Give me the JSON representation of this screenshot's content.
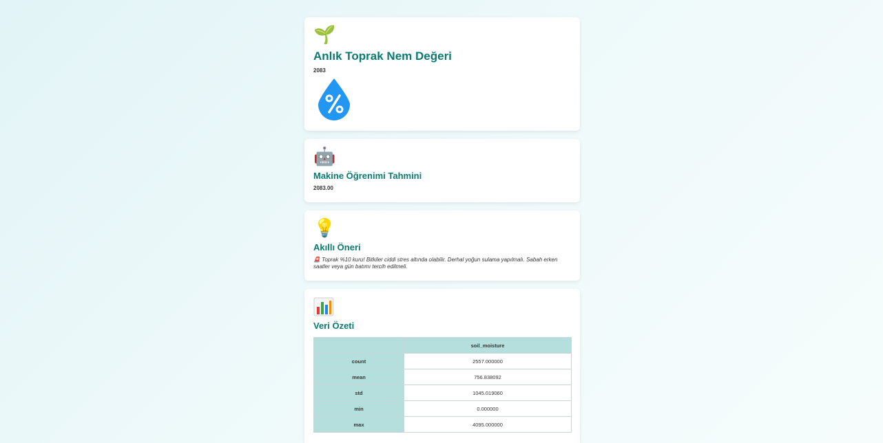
{
  "card1": {
    "icon": "seedling-icon",
    "title": "Anlık Toprak Nem Değeri",
    "value": "2083",
    "image": "humidity-drop-icon"
  },
  "card2": {
    "icon": "robot-icon",
    "title": "Makine Öğrenimi Tahmini",
    "value": "2083.00"
  },
  "card3": {
    "icon": "lightbulb-icon",
    "title": "Akıllı Öneri",
    "text": "🚨 Toprak %10 kuru! Bitkiler ciddi stres altında olabilir. Derhal yoğun sulama yapılmalı. Sabah erken saatler veya gün batımı tercih edilmeli."
  },
  "card4": {
    "icon": "bar-chart-icon",
    "title": "Veri Özeti",
    "table": {
      "column": "soil_moisture",
      "rows": [
        {
          "label": "count",
          "value": "2557.000000"
        },
        {
          "label": "mean",
          "value": "756.838092"
        },
        {
          "label": "std",
          "value": "1045.019060"
        },
        {
          "label": "min",
          "value": "0.000000"
        },
        {
          "label": "max",
          "value": "4095.000000"
        }
      ]
    }
  },
  "colors": {
    "accent": "#0b7a70",
    "drop": "#2196f3",
    "table_header": "#b5dfdc"
  }
}
